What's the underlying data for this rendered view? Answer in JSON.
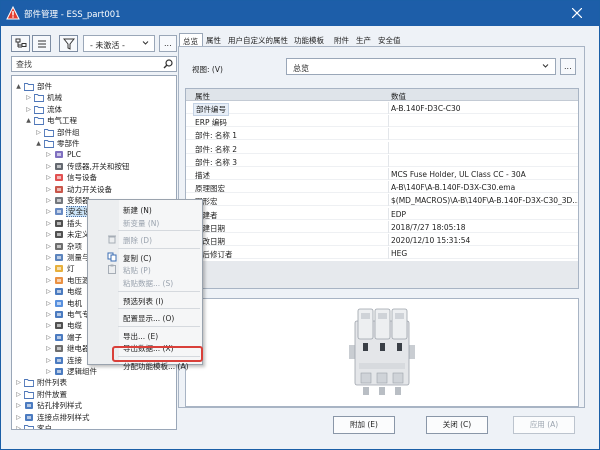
{
  "window": {
    "title": "部件管理 - ESS_part001",
    "icon": "warning-triangle-icon"
  },
  "toolbar": {
    "filter_value": "- 未激活 -",
    "more_label": "...",
    "search_placeholder": "查找"
  },
  "tree": [
    {
      "label": "部件",
      "level": 0,
      "toggle": "▲",
      "icon": "folder-icon"
    },
    {
      "label": "机械",
      "level": 1,
      "toggle": "▷",
      "icon": "folder-icon"
    },
    {
      "label": "流体",
      "level": 1,
      "toggle": "▷",
      "icon": "folder-icon"
    },
    {
      "label": "电气工程",
      "level": 1,
      "toggle": "▲",
      "icon": "folder-icon"
    },
    {
      "label": "部件组",
      "level": 2,
      "toggle": "▷",
      "icon": "folder-icon"
    },
    {
      "label": "零部件",
      "level": 2,
      "toggle": "▲",
      "icon": "folder-icon"
    },
    {
      "label": "PLC",
      "level": 3,
      "toggle": "▷",
      "icon": "plc-icon"
    },
    {
      "label": "传感器,开关和按钮",
      "level": 3,
      "toggle": "▷",
      "icon": "sensor-icon"
    },
    {
      "label": "信号设备",
      "level": 3,
      "toggle": "▷",
      "icon": "signal-device-icon"
    },
    {
      "label": "动力开关设备",
      "level": 3,
      "toggle": "▷",
      "icon": "power-switch-icon"
    },
    {
      "label": "变频器",
      "level": 3,
      "toggle": "▷",
      "icon": "inverter-icon"
    },
    {
      "label": "安全设备",
      "level": 3,
      "toggle": "▷",
      "icon": "safety-device-icon",
      "selected": true
    },
    {
      "label": "插头",
      "level": 3,
      "toggle": "▷",
      "icon": "plug-icon"
    },
    {
      "label": "未定义",
      "level": 3,
      "toggle": "▷",
      "icon": "undefined-icon"
    },
    {
      "label": "杂项",
      "level": 3,
      "toggle": "▷",
      "icon": "misc-icon"
    },
    {
      "label": "测量与控",
      "level": 3,
      "toggle": "▷",
      "icon": "measure-icon"
    },
    {
      "label": "灯",
      "level": 3,
      "toggle": "▷",
      "icon": "lamp-icon"
    },
    {
      "label": "电压源和",
      "level": 3,
      "toggle": "▷",
      "icon": "voltage-source-icon"
    },
    {
      "label": "电缆",
      "level": 3,
      "toggle": "▷",
      "icon": "cable-icon"
    },
    {
      "label": "电机",
      "level": 3,
      "toggle": "▷",
      "icon": "motor-icon"
    },
    {
      "label": "电气专用",
      "level": 3,
      "toggle": "▷",
      "icon": "electric-special-icon"
    },
    {
      "label": "电缆",
      "level": 3,
      "toggle": "▷",
      "icon": "wire-icon"
    },
    {
      "label": "端子",
      "level": 3,
      "toggle": "▷",
      "icon": "terminal-icon"
    },
    {
      "label": "继电器,",
      "level": 3,
      "toggle": "▷",
      "icon": "relay-icon"
    },
    {
      "label": "连接",
      "level": 3,
      "toggle": "▷",
      "icon": "connection-icon"
    },
    {
      "label": "逻辑组件",
      "level": 3,
      "toggle": "▷",
      "icon": "logic-icon"
    },
    {
      "label": "附件列表",
      "level": 0,
      "toggle": "▷",
      "icon": "folder-icon"
    },
    {
      "label": "附件放置",
      "level": 0,
      "toggle": "▷",
      "icon": "folder-icon"
    },
    {
      "label": "钻孔排列样式",
      "level": 0,
      "toggle": "▷",
      "icon": "drill-icon"
    },
    {
      "label": "连接点排列样式",
      "level": 0,
      "toggle": "▷",
      "icon": "connect-point-icon"
    },
    {
      "label": "客户",
      "level": 0,
      "toggle": "▷",
      "icon": "folder-icon"
    },
    {
      "label": "制造商/供应商",
      "level": 0,
      "toggle": "▷",
      "icon": "folder-icon"
    }
  ],
  "tabs": [
    "总览",
    "属性",
    "用户自定义的属性",
    "功能模板",
    "附件",
    "生产",
    "安全值"
  ],
  "view": {
    "label": "视图: (V)",
    "value": "总览",
    "more_label": "..."
  },
  "props": {
    "col_name": "属性",
    "col_value": "数值",
    "rows": [
      {
        "name": "部件编号",
        "value": "A-B.140F-D3C-C30",
        "selected": true
      },
      {
        "name": "ERP 编码",
        "value": ""
      },
      {
        "name": "部件: 名称 1",
        "value": ""
      },
      {
        "name": "部件: 名称 2",
        "value": ""
      },
      {
        "name": "部件: 名称 3",
        "value": ""
      },
      {
        "name": "描述",
        "value": "MCS Fuse Holder, UL Class CC - 30A"
      },
      {
        "name": "原理图宏",
        "value": "A-B\\140F\\A-B.140F-D3X-C30.ema"
      },
      {
        "name": "图形宏",
        "value": "$(MD_MACROS)\\A-B\\140F\\A-B.140F-D3X-C30_3D..."
      },
      {
        "name": "创建者",
        "value": "EDP"
      },
      {
        "name": "创建日期",
        "value": "2018/7/27 18:05:18"
      },
      {
        "name": "更改日期",
        "value": "2020/12/10 15:31:54"
      },
      {
        "name": "最后修订者",
        "value": "HEG"
      }
    ]
  },
  "buttons": {
    "add": "附加 (E)",
    "close": "关闭 (C)",
    "apply": "应用 (A)"
  },
  "context_menu": [
    {
      "label": "新建 (N)",
      "enabled": true
    },
    {
      "label": "新变量 (N)",
      "enabled": false
    },
    {
      "sep": true
    },
    {
      "label": "删除 (D)",
      "enabled": false,
      "icon": "delete-icon"
    },
    {
      "sep": true
    },
    {
      "label": "复制 (C)",
      "enabled": true,
      "icon": "copy-icon"
    },
    {
      "label": "粘贴 (P)",
      "enabled": false,
      "icon": "paste-icon"
    },
    {
      "label": "粘贴数据... (S)",
      "enabled": false
    },
    {
      "sep": true
    },
    {
      "label": "预选列表 (I)",
      "enabled": true
    },
    {
      "sep": true
    },
    {
      "label": "配置显示... (O)",
      "enabled": true
    },
    {
      "sep": true
    },
    {
      "label": "导出... (E)",
      "enabled": true
    },
    {
      "label": "导出数据... (X)",
      "enabled": true
    },
    {
      "sep": true
    },
    {
      "label": "分配功能模板... (A)",
      "enabled": true,
      "highlighted": true
    }
  ],
  "colors": {
    "titlebar": "#1d5ea9",
    "highlight_box": "#d9403a",
    "selection": "#cce4f7"
  }
}
